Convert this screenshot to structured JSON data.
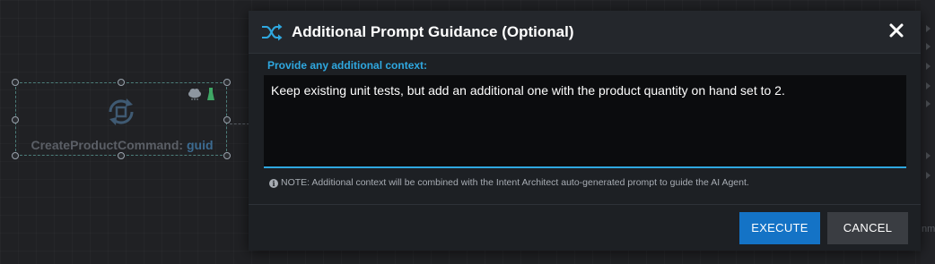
{
  "canvas": {
    "node": {
      "name": "CreateProductCommand:",
      "type": "guid",
      "icon": "command-cycle-icon",
      "badges": [
        "cloud-icon",
        "flask-icon"
      ]
    },
    "right_strip_snippet": "nm"
  },
  "dialog": {
    "title": "Additional Prompt Guidance (Optional)",
    "title_icon": "shuffle-icon",
    "close_icon": "close-icon",
    "field_label": "Provide any additional context:",
    "textarea_value": "Keep existing unit tests, but add an additional one with the product quantity on hand set to 2.",
    "note_icon": "info-icon",
    "note": "NOTE: Additional context will be combined with the Intent Architect auto-generated prompt to guide the AI Agent.",
    "buttons": {
      "execute": "EXECUTE",
      "cancel": "CANCEL"
    }
  },
  "colors": {
    "accent": "#2fa8e0",
    "primary_button": "#1473c6",
    "secondary_button": "#3a3d42",
    "dialog_bg": "#1d2024"
  }
}
